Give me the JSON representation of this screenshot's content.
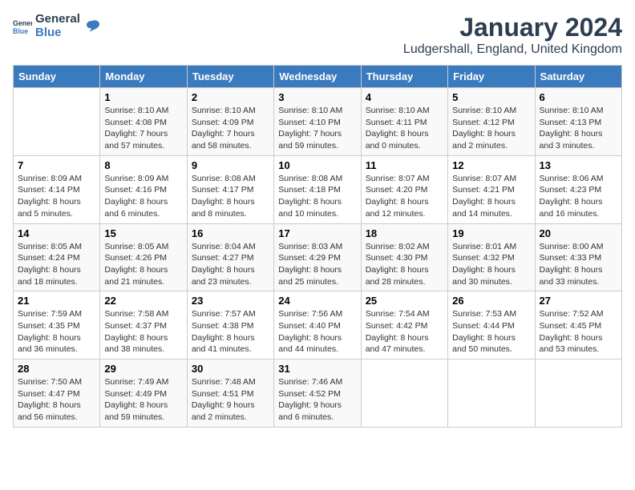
{
  "header": {
    "logo_general": "General",
    "logo_blue": "Blue",
    "title": "January 2024",
    "subtitle": "Ludgershall, England, United Kingdom"
  },
  "days_of_week": [
    "Sunday",
    "Monday",
    "Tuesday",
    "Wednesday",
    "Thursday",
    "Friday",
    "Saturday"
  ],
  "weeks": [
    [
      {
        "day": "",
        "info": ""
      },
      {
        "day": "1",
        "info": "Sunrise: 8:10 AM\nSunset: 4:08 PM\nDaylight: 7 hours\nand 57 minutes."
      },
      {
        "day": "2",
        "info": "Sunrise: 8:10 AM\nSunset: 4:09 PM\nDaylight: 7 hours\nand 58 minutes."
      },
      {
        "day": "3",
        "info": "Sunrise: 8:10 AM\nSunset: 4:10 PM\nDaylight: 7 hours\nand 59 minutes."
      },
      {
        "day": "4",
        "info": "Sunrise: 8:10 AM\nSunset: 4:11 PM\nDaylight: 8 hours\nand 0 minutes."
      },
      {
        "day": "5",
        "info": "Sunrise: 8:10 AM\nSunset: 4:12 PM\nDaylight: 8 hours\nand 2 minutes."
      },
      {
        "day": "6",
        "info": "Sunrise: 8:10 AM\nSunset: 4:13 PM\nDaylight: 8 hours\nand 3 minutes."
      }
    ],
    [
      {
        "day": "7",
        "info": "Sunrise: 8:09 AM\nSunset: 4:14 PM\nDaylight: 8 hours\nand 5 minutes."
      },
      {
        "day": "8",
        "info": "Sunrise: 8:09 AM\nSunset: 4:16 PM\nDaylight: 8 hours\nand 6 minutes."
      },
      {
        "day": "9",
        "info": "Sunrise: 8:08 AM\nSunset: 4:17 PM\nDaylight: 8 hours\nand 8 minutes."
      },
      {
        "day": "10",
        "info": "Sunrise: 8:08 AM\nSunset: 4:18 PM\nDaylight: 8 hours\nand 10 minutes."
      },
      {
        "day": "11",
        "info": "Sunrise: 8:07 AM\nSunset: 4:20 PM\nDaylight: 8 hours\nand 12 minutes."
      },
      {
        "day": "12",
        "info": "Sunrise: 8:07 AM\nSunset: 4:21 PM\nDaylight: 8 hours\nand 14 minutes."
      },
      {
        "day": "13",
        "info": "Sunrise: 8:06 AM\nSunset: 4:23 PM\nDaylight: 8 hours\nand 16 minutes."
      }
    ],
    [
      {
        "day": "14",
        "info": "Sunrise: 8:05 AM\nSunset: 4:24 PM\nDaylight: 8 hours\nand 18 minutes."
      },
      {
        "day": "15",
        "info": "Sunrise: 8:05 AM\nSunset: 4:26 PM\nDaylight: 8 hours\nand 21 minutes."
      },
      {
        "day": "16",
        "info": "Sunrise: 8:04 AM\nSunset: 4:27 PM\nDaylight: 8 hours\nand 23 minutes."
      },
      {
        "day": "17",
        "info": "Sunrise: 8:03 AM\nSunset: 4:29 PM\nDaylight: 8 hours\nand 25 minutes."
      },
      {
        "day": "18",
        "info": "Sunrise: 8:02 AM\nSunset: 4:30 PM\nDaylight: 8 hours\nand 28 minutes."
      },
      {
        "day": "19",
        "info": "Sunrise: 8:01 AM\nSunset: 4:32 PM\nDaylight: 8 hours\nand 30 minutes."
      },
      {
        "day": "20",
        "info": "Sunrise: 8:00 AM\nSunset: 4:33 PM\nDaylight: 8 hours\nand 33 minutes."
      }
    ],
    [
      {
        "day": "21",
        "info": "Sunrise: 7:59 AM\nSunset: 4:35 PM\nDaylight: 8 hours\nand 36 minutes."
      },
      {
        "day": "22",
        "info": "Sunrise: 7:58 AM\nSunset: 4:37 PM\nDaylight: 8 hours\nand 38 minutes."
      },
      {
        "day": "23",
        "info": "Sunrise: 7:57 AM\nSunset: 4:38 PM\nDaylight: 8 hours\nand 41 minutes."
      },
      {
        "day": "24",
        "info": "Sunrise: 7:56 AM\nSunset: 4:40 PM\nDaylight: 8 hours\nand 44 minutes."
      },
      {
        "day": "25",
        "info": "Sunrise: 7:54 AM\nSunset: 4:42 PM\nDaylight: 8 hours\nand 47 minutes."
      },
      {
        "day": "26",
        "info": "Sunrise: 7:53 AM\nSunset: 4:44 PM\nDaylight: 8 hours\nand 50 minutes."
      },
      {
        "day": "27",
        "info": "Sunrise: 7:52 AM\nSunset: 4:45 PM\nDaylight: 8 hours\nand 53 minutes."
      }
    ],
    [
      {
        "day": "28",
        "info": "Sunrise: 7:50 AM\nSunset: 4:47 PM\nDaylight: 8 hours\nand 56 minutes."
      },
      {
        "day": "29",
        "info": "Sunrise: 7:49 AM\nSunset: 4:49 PM\nDaylight: 8 hours\nand 59 minutes."
      },
      {
        "day": "30",
        "info": "Sunrise: 7:48 AM\nSunset: 4:51 PM\nDaylight: 9 hours\nand 2 minutes."
      },
      {
        "day": "31",
        "info": "Sunrise: 7:46 AM\nSunset: 4:52 PM\nDaylight: 9 hours\nand 6 minutes."
      },
      {
        "day": "",
        "info": ""
      },
      {
        "day": "",
        "info": ""
      },
      {
        "day": "",
        "info": ""
      }
    ]
  ]
}
